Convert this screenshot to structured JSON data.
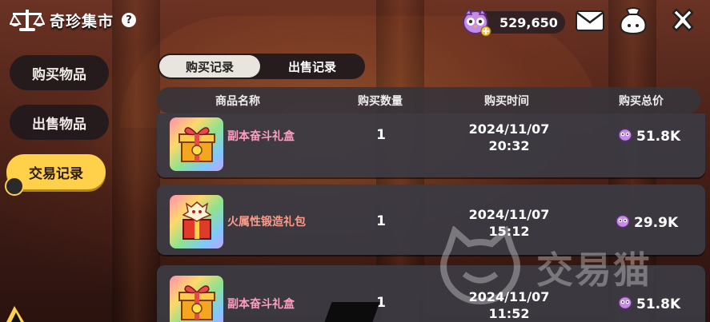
{
  "header": {
    "title": "奇珍集市",
    "help_label": "?",
    "currency_value": "529,650"
  },
  "nav": {
    "buy_label": "购买物品",
    "sell_label": "出售物品",
    "trade_label": "交易记录"
  },
  "tabs": {
    "buy_records": "购买记录",
    "sell_records": "出售记录"
  },
  "table": {
    "headers": [
      "商品名称",
      "购买数量",
      "购买时间",
      "购买总价"
    ],
    "rows": [
      {
        "name": "副本奋斗礼盒",
        "qty": "1",
        "date": "2024/11/07",
        "time": "20:32",
        "price": "51.8K",
        "icon": "gift-box-icon"
      },
      {
        "name": "火属性锻造礼包",
        "qty": "1",
        "date": "2024/11/07",
        "time": "15:12",
        "price": "29.9K",
        "icon": "dragon-gift-icon"
      },
      {
        "name": "副本奋斗礼盒",
        "qty": "1",
        "date": "2024/11/07",
        "time": "11:52",
        "price": "51.8K",
        "icon": "gift-box-icon"
      }
    ]
  },
  "watermark": {
    "text": "交易猫"
  },
  "colors": {
    "active_nav": "#ffd04a",
    "row_bg": "#3c3a42",
    "header_bg": "#37343a"
  }
}
